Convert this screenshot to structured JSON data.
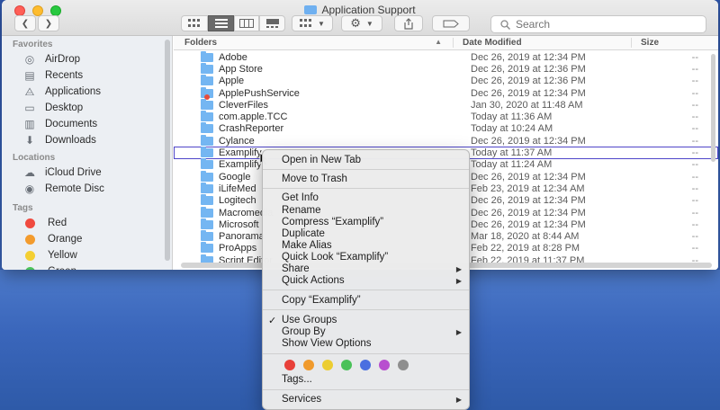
{
  "window": {
    "title": "Application Support"
  },
  "toolbar": {
    "back_icon": "chevron-left-icon",
    "forward_icon": "chevron-right-icon",
    "search_placeholder": "Search",
    "view_modes": [
      "icon-view",
      "list-view",
      "column-view",
      "gallery-view"
    ],
    "active_view": "list-view"
  },
  "sidebar": {
    "favorites_header": "Favorites",
    "favorites": [
      {
        "label": "AirDrop",
        "icon": "airdrop-icon"
      },
      {
        "label": "Recents",
        "icon": "recents-icon"
      },
      {
        "label": "Applications",
        "icon": "applications-icon"
      },
      {
        "label": "Desktop",
        "icon": "desktop-icon"
      },
      {
        "label": "Documents",
        "icon": "documents-icon"
      },
      {
        "label": "Downloads",
        "icon": "downloads-icon"
      }
    ],
    "locations_header": "Locations",
    "locations": [
      {
        "label": "iCloud Drive",
        "icon": "cloud-icon"
      },
      {
        "label": "Remote Disc",
        "icon": "disc-icon"
      }
    ],
    "tags_header": "Tags",
    "tags": [
      {
        "label": "Red",
        "color": "#f04a3f"
      },
      {
        "label": "Orange",
        "color": "#f39b2d"
      },
      {
        "label": "Yellow",
        "color": "#f4cf32"
      },
      {
        "label": "Green",
        "color": "#4bc35a"
      }
    ]
  },
  "list": {
    "headers": {
      "name": "Folders",
      "date": "Date Modified",
      "size": "Size"
    },
    "rows": [
      {
        "name": "Adobe",
        "date": "Dec 26, 2019 at 12:34 PM",
        "size": "--"
      },
      {
        "name": "App Store",
        "date": "Dec 26, 2019 at 12:36 PM",
        "size": "--"
      },
      {
        "name": "Apple",
        "date": "Dec 26, 2019 at 12:36 PM",
        "size": "--"
      },
      {
        "name": "ApplePushService",
        "date": "Dec 26, 2019 at 12:34 PM",
        "size": "--",
        "badge": true
      },
      {
        "name": "CleverFiles",
        "date": "Jan 30, 2020 at 11:48 AM",
        "size": "--"
      },
      {
        "name": "com.apple.TCC",
        "date": "Today at 11:36 AM",
        "size": "--"
      },
      {
        "name": "CrashReporter",
        "date": "Today at 10:24 AM",
        "size": "--"
      },
      {
        "name": "Cylance",
        "date": "Dec 26, 2019 at 12:34 PM",
        "size": "--"
      },
      {
        "name": "Examplify",
        "date": "Today at 11:37 AM",
        "size": "--",
        "selected": true
      },
      {
        "name": "Examplify",
        "date": "Today at 11:24 AM",
        "size": "--"
      },
      {
        "name": "Google",
        "date": "Dec 26, 2019 at 12:34 PM",
        "size": "--"
      },
      {
        "name": "iLifeMed",
        "date": "Feb 23, 2019 at 12:34 AM",
        "size": "--"
      },
      {
        "name": "Logitech",
        "date": "Dec 26, 2019 at 12:34 PM",
        "size": "--"
      },
      {
        "name": "Macromedia",
        "date": "Dec 26, 2019 at 12:34 PM",
        "size": "--"
      },
      {
        "name": "Microsoft",
        "date": "Dec 26, 2019 at 12:34 PM",
        "size": "--"
      },
      {
        "name": "Panorama",
        "date": "Mar 18, 2020 at 8:44 AM",
        "size": "--"
      },
      {
        "name": "ProApps",
        "date": "Feb 22, 2019 at 8:28 PM",
        "size": "--"
      },
      {
        "name": "Script Editor",
        "date": "Feb 22, 2019 at 11:37 PM",
        "size": "--"
      }
    ]
  },
  "context_menu": {
    "items": {
      "open_new_tab": "Open in New Tab",
      "move_to_trash": "Move to Trash",
      "get_info": "Get Info",
      "rename": "Rename",
      "compress": "Compress “Examplify”",
      "duplicate": "Duplicate",
      "make_alias": "Make Alias",
      "quick_look": "Quick Look “Examplify”",
      "share": "Share",
      "quick_actions": "Quick Actions",
      "copy": "Copy “Examplify”",
      "use_groups": "Use Groups",
      "group_by": "Group By",
      "show_view_options": "Show View Options",
      "tags": "Tags...",
      "services": "Services"
    },
    "submenu_arrow": "▶",
    "check_mark": "✓",
    "tag_colors": [
      "#e8403a",
      "#f09a2c",
      "#eccd31",
      "#49c158",
      "#4a6fe0",
      "#b84fcf",
      "#8e8e8e"
    ]
  }
}
